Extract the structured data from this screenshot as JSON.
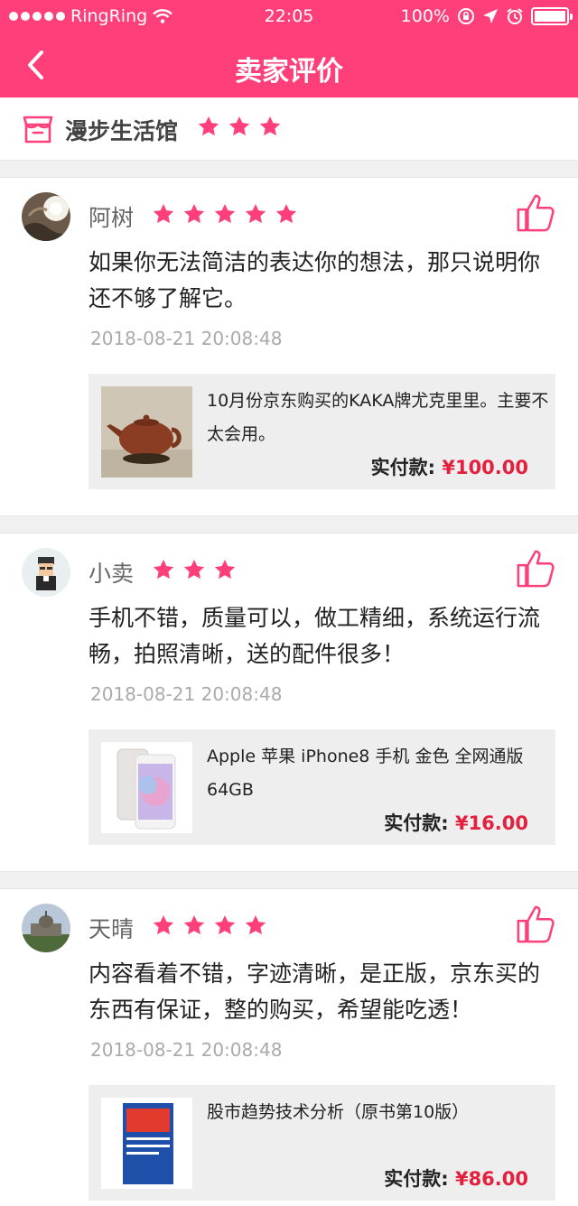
{
  "status_bar": {
    "carrier": "RingRing",
    "time": "22:05",
    "battery": "100%"
  },
  "header": {
    "title": "卖家评价",
    "back_icon": "chevron-left-icon"
  },
  "shop": {
    "name": "漫步生活馆",
    "rating": 3,
    "icon": "store-icon"
  },
  "reviews": [
    {
      "user": "阿树",
      "rating": 5,
      "text": "如果你无法简洁的表达你的想法，那只说明你还不够了解它。",
      "date": "2018-08-21 20:08:48",
      "product": {
        "name": "10月份京东购买的KAKA牌尤克里里。主要不太会用。",
        "price_label": "实付款:",
        "price": "¥100.00"
      }
    },
    {
      "user": "小卖",
      "rating": 3,
      "text": "手机不错，质量可以，做工精细，系统运行流畅，拍照清晰，送的配件很多！",
      "date": "2018-08-21 20:08:48",
      "product": {
        "name": "Apple 苹果 iPhone8 手机 金色 全网通版 64GB",
        "price_label": "实付款:",
        "price": "¥16.00"
      }
    },
    {
      "user": "天晴",
      "rating": 4,
      "text": "内容看着不错，字迹清晰，是正版，京东买的东西有保证，整的购买，希望能吃透！",
      "date": "2018-08-21 20:08:48",
      "product": {
        "name": "股市趋势技术分析（原书第10版）",
        "price_label": "实付款:",
        "price": "¥86.00"
      }
    }
  ],
  "colors": {
    "accent": "#ff3f7a",
    "price": "#e4203f"
  }
}
